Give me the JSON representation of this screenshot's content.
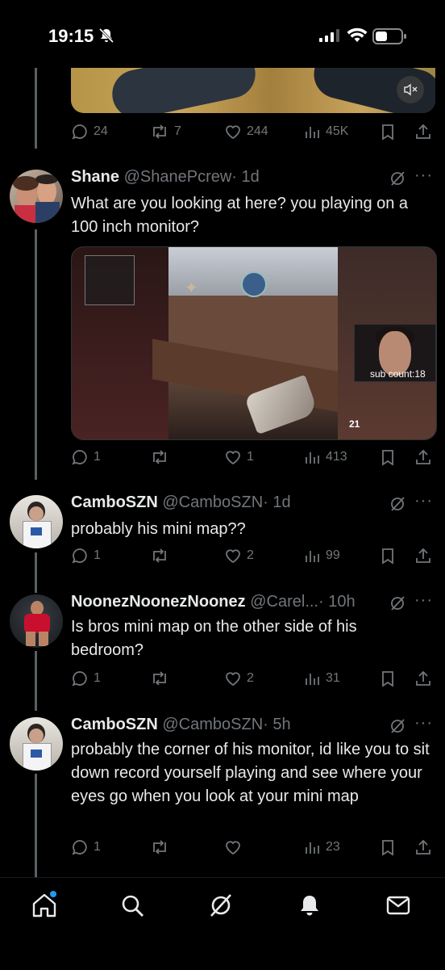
{
  "status_bar": {
    "time": "19:15"
  },
  "prev_tweet": {
    "actions": {
      "replies": "24",
      "reposts": "7",
      "likes": "244",
      "views": "45K"
    }
  },
  "tweets": [
    {
      "name": "Shane",
      "handle": "@ShanePcrew",
      "time": "· 1d",
      "text": "What are you looking at here? you playing on a 100 inch monitor?",
      "media_overlay": "sub count:18",
      "media_ammo": "21",
      "actions": {
        "replies": "1",
        "reposts": "",
        "likes": "1",
        "views": "413"
      }
    },
    {
      "name": "CamboSZN",
      "handle": "@CamboSZN",
      "time": "· 1d",
      "text": "probably his mini map??",
      "actions": {
        "replies": "1",
        "reposts": "",
        "likes": "2",
        "views": "99"
      }
    },
    {
      "name": "NoonezNoonezNoonez",
      "handle": "@Carel...",
      "time": "· 10h",
      "text": "Is bros mini map on the other side of his bedroom?",
      "actions": {
        "replies": "1",
        "reposts": "",
        "likes": "2",
        "views": "31"
      }
    },
    {
      "name": "CamboSZN",
      "handle": "@CamboSZN",
      "time": "· 5h",
      "text": "probably the corner of his monitor, id like you to sit down record yourself playing and see where your eyes go when you look at your mini map",
      "actions": {
        "replies": "1",
        "reposts": "",
        "likes": "",
        "views": "23"
      }
    }
  ],
  "nav": {
    "items": [
      "home-icon",
      "search-icon",
      "grok-icon",
      "notifications-icon",
      "messages-icon"
    ]
  },
  "colors": {
    "background": "#000000",
    "text": "#e7e9ea",
    "muted": "#71767b",
    "accent": "#1d9bf0"
  }
}
